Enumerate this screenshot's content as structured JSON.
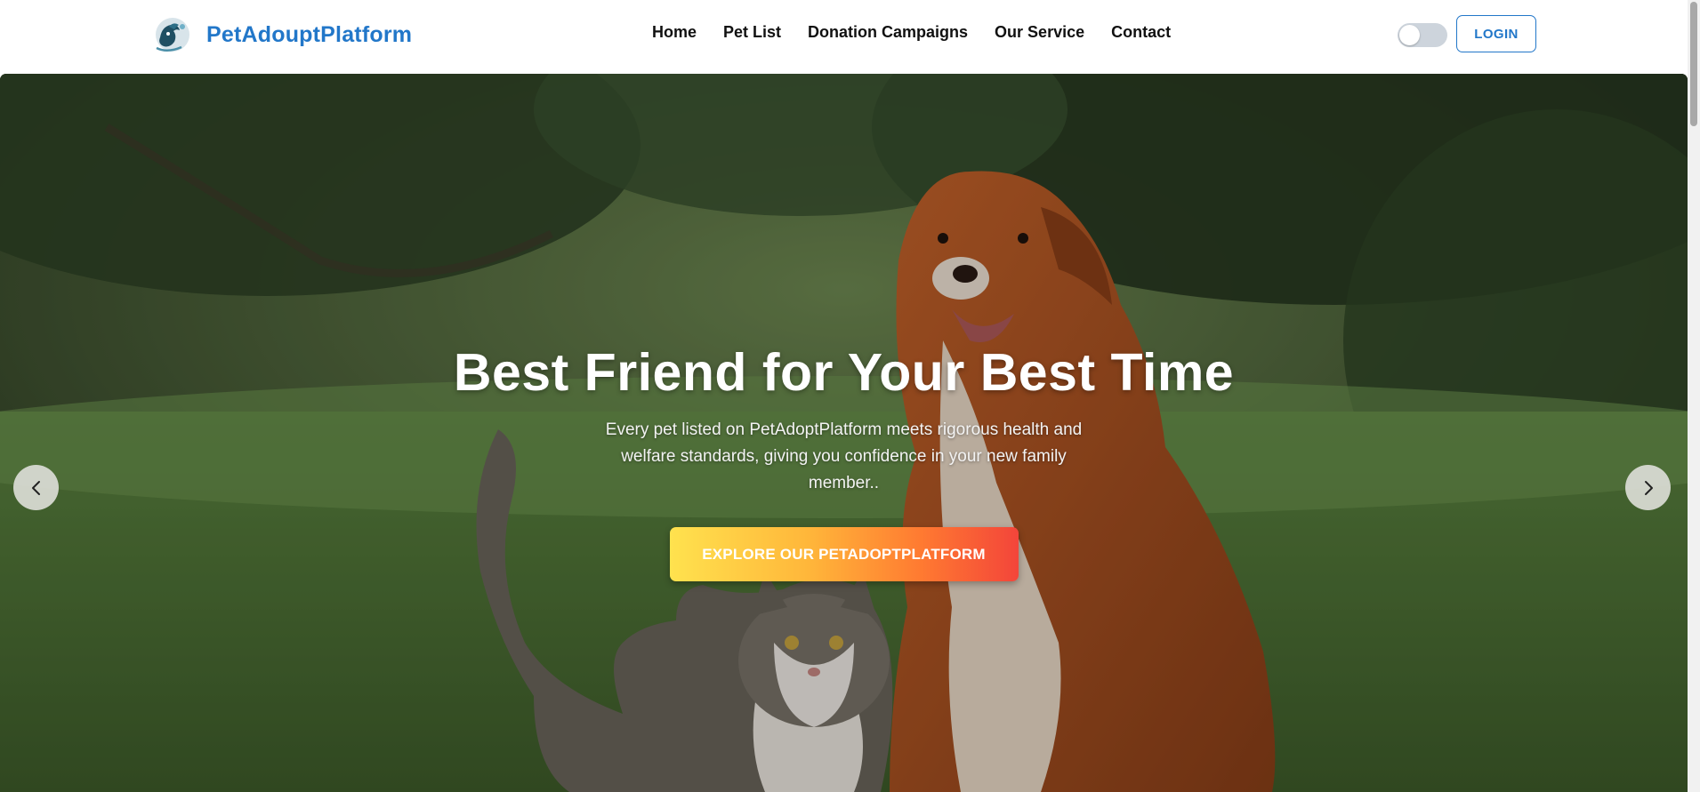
{
  "brand": {
    "name": "PetAdouptPlatform",
    "logo_icon": "dog-globe-logo-icon",
    "color": "#2277c9"
  },
  "nav": {
    "items": [
      {
        "label": "Home"
      },
      {
        "label": "Pet List"
      },
      {
        "label": "Donation Campaigns"
      },
      {
        "label": "Our Service"
      },
      {
        "label": "Contact"
      }
    ]
  },
  "theme_toggle": {
    "icon": "theme-toggle-icon",
    "state": "off"
  },
  "login": {
    "label": "LOGIN"
  },
  "hero": {
    "title": "Best Friend for Your Best Time",
    "text": "Every pet listed on PetAdoptPlatform meets rigorous health and welfare standards, giving you confidence in your new family member..",
    "cta_label": "EXPLORE OUR PETADOPTPLATFORM",
    "cta_gradient": [
      "#ffe24e",
      "#ff7a31",
      "#f3453a"
    ],
    "image_subject": "dog and cat sitting on grass",
    "prev_icon": "chevron-left-icon",
    "next_icon": "chevron-right-icon"
  }
}
